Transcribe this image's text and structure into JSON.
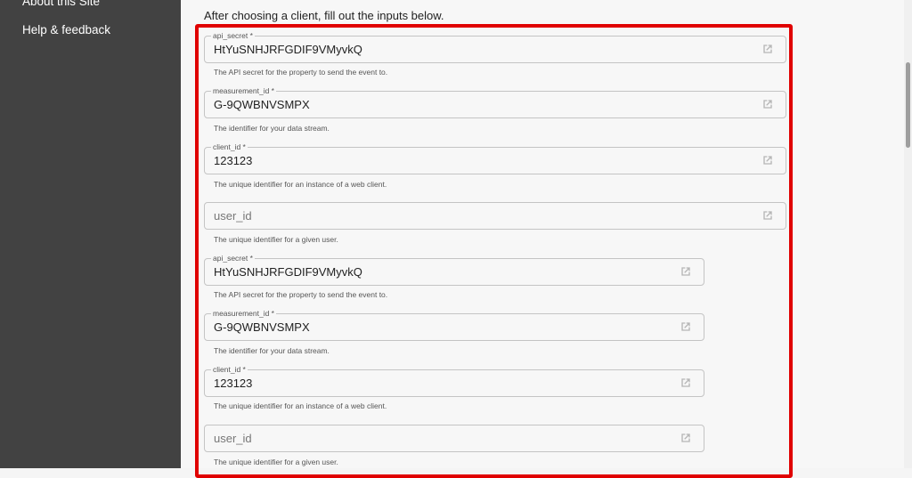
{
  "sidebar": {
    "items": [
      {
        "label": "About this Site"
      },
      {
        "label": "Help & feedback"
      }
    ]
  },
  "main": {
    "intro": "After choosing a client, fill out the inputs below.",
    "fields": [
      {
        "label": "api_secret *",
        "value": "HtYuSNHJRFGDIF9VMyvkQ",
        "helper": "The API secret for the property to send the event to."
      },
      {
        "label": "measurement_id *",
        "value": "G-9QWBNVSMPX",
        "helper": "The identifier for your data stream."
      },
      {
        "label": "client_id *",
        "value": "123123",
        "helper": "The unique identifier for an instance of a web client."
      },
      {
        "placeholder": "user_id",
        "helper": "The unique identifier for a given user."
      },
      {
        "label": "api_secret *",
        "value": "HtYuSNHJRFGDIF9VMyvkQ",
        "helper": "The API secret for the property to send the event to."
      },
      {
        "label": "measurement_id *",
        "value": "G-9QWBNVSMPX",
        "helper": "The identifier for your data stream."
      },
      {
        "label": "client_id *",
        "value": "123123",
        "helper": "The unique identifier for an instance of a web client."
      },
      {
        "placeholder": "user_id",
        "helper": "The unique identifier for a given user."
      }
    ]
  },
  "colors": {
    "sidebar_bg": "#424242",
    "highlight_border": "#e00000",
    "page_bg": "#f7f7f7"
  },
  "icons": {
    "field_action": "open-in-new-icon"
  }
}
